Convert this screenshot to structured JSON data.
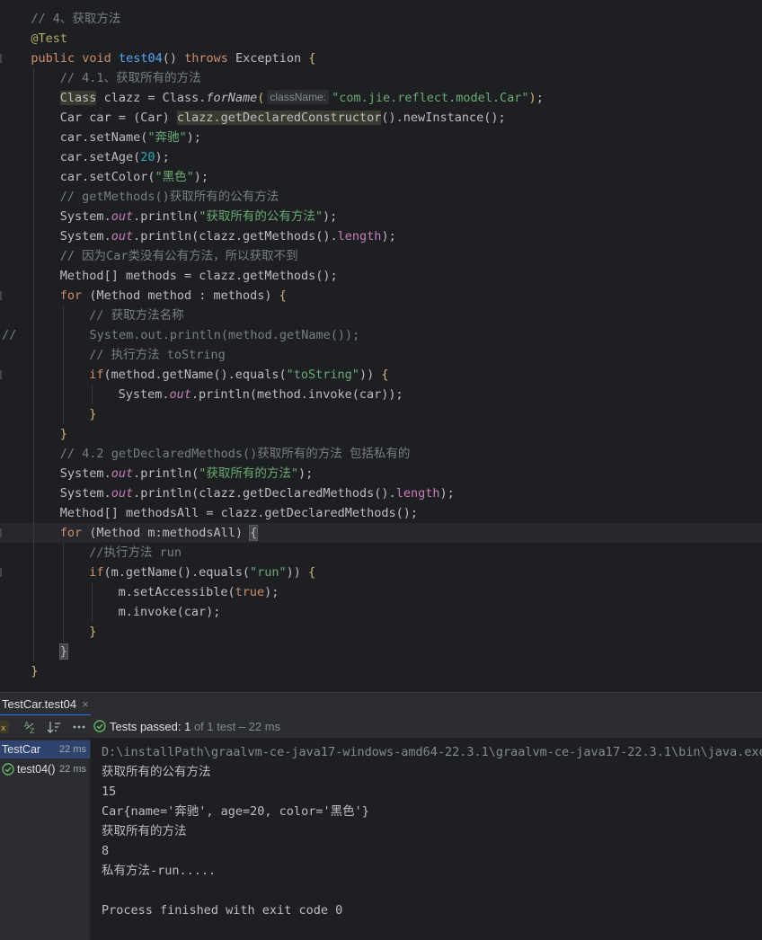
{
  "editor": {
    "lines": [
      {
        "indent": 4,
        "tokens": [
          [
            "com",
            "// 4、获取方法"
          ]
        ]
      },
      {
        "indent": 4,
        "tokens": [
          [
            "ann",
            "@Test"
          ]
        ]
      },
      {
        "indent": 4,
        "tokens": [
          [
            "kw",
            "public "
          ],
          [
            "kw",
            "void "
          ],
          [
            "mdecl",
            "test04"
          ],
          [
            "",
            "() "
          ],
          [
            "kw",
            "throws "
          ],
          [
            "",
            "Exception "
          ],
          [
            "pb1",
            "{"
          ]
        ]
      },
      {
        "indent": 8,
        "tokens": [
          [
            "com",
            "// 4.1、获取所有的方法"
          ]
        ]
      },
      {
        "indent": 8,
        "tokens": [
          [
            "bg-warn",
            "Class"
          ],
          [
            "",
            " clazz = Class."
          ],
          [
            "it",
            "forName"
          ],
          [
            "pb1",
            "("
          ],
          [
            "hint",
            "className:"
          ],
          [
            "str",
            "\"com.jie.reflect.model.Car\""
          ],
          [
            "pb1",
            ")"
          ],
          [
            "",
            ";"
          ]
        ]
      },
      {
        "indent": 8,
        "tokens": [
          [
            "",
            "Car car = (Car) "
          ],
          [
            "bg-warn",
            "clazz.getDeclaredConstructor"
          ],
          [
            "",
            "().newInstance();"
          ]
        ]
      },
      {
        "indent": 8,
        "tokens": [
          [
            "",
            "car.setName("
          ],
          [
            "str",
            "\"奔驰\""
          ],
          [
            "",
            ");"
          ]
        ]
      },
      {
        "indent": 8,
        "tokens": [
          [
            "",
            "car.setAge("
          ],
          [
            "num",
            "20"
          ],
          [
            "",
            ");"
          ]
        ]
      },
      {
        "indent": 8,
        "tokens": [
          [
            "",
            "car.setColor("
          ],
          [
            "str",
            "\"黑色\""
          ],
          [
            "",
            ");"
          ]
        ]
      },
      {
        "indent": 8,
        "tokens": [
          [
            "com",
            "// getMethods()获取所有的公有方法"
          ]
        ]
      },
      {
        "indent": 8,
        "tokens": [
          [
            "",
            "System."
          ],
          [
            "fld it",
            "out"
          ],
          [
            "",
            ".println("
          ],
          [
            "str",
            "\"获取所有的公有方法\""
          ],
          [
            "",
            ");"
          ]
        ]
      },
      {
        "indent": 8,
        "tokens": [
          [
            "",
            "System."
          ],
          [
            "fld it",
            "out"
          ],
          [
            "",
            ".println(clazz.getMethods()."
          ],
          [
            "fld",
            "length"
          ],
          [
            "",
            ");"
          ]
        ]
      },
      {
        "indent": 8,
        "tokens": [
          [
            "com",
            "// 因为Car类没有公有方法，所以获取不到"
          ]
        ]
      },
      {
        "indent": 8,
        "tokens": [
          [
            "",
            "Method[] methods = clazz.getMethods();"
          ]
        ]
      },
      {
        "indent": 8,
        "tokens": [
          [
            "kw",
            "for "
          ],
          [
            "",
            "(Method method : methods) "
          ],
          [
            "pb1",
            "{"
          ]
        ]
      },
      {
        "indent": 12,
        "tokens": [
          [
            "com",
            "// 获取方法名称"
          ]
        ]
      },
      {
        "indent": 0,
        "tokens": [
          [
            "com",
            "//          System.out.println(method.getName());"
          ]
        ]
      },
      {
        "indent": 12,
        "tokens": [
          [
            "com",
            "// 执行方法 toString"
          ]
        ]
      },
      {
        "indent": 12,
        "tokens": [
          [
            "kw",
            "if"
          ],
          [
            "",
            "(method.getName().equals("
          ],
          [
            "str",
            "\"toString\""
          ],
          [
            "",
            ")) "
          ],
          [
            "pb1",
            "{"
          ]
        ]
      },
      {
        "indent": 16,
        "tokens": [
          [
            "",
            "System."
          ],
          [
            "fld it",
            "out"
          ],
          [
            "",
            ".println(method.invoke(car));"
          ]
        ]
      },
      {
        "indent": 12,
        "tokens": [
          [
            "pb1",
            "}"
          ]
        ]
      },
      {
        "indent": 8,
        "tokens": [
          [
            "pb1",
            "}"
          ]
        ]
      },
      {
        "indent": 8,
        "tokens": [
          [
            "com",
            "// 4.2 getDeclaredMethods()获取所有的方法 包括私有的"
          ]
        ]
      },
      {
        "indent": 8,
        "tokens": [
          [
            "",
            "System."
          ],
          [
            "fld it",
            "out"
          ],
          [
            "",
            ".println("
          ],
          [
            "str",
            "\"获取所有的方法\""
          ],
          [
            "",
            ");"
          ]
        ]
      },
      {
        "indent": 8,
        "tokens": [
          [
            "",
            "System."
          ],
          [
            "fld it",
            "out"
          ],
          [
            "",
            ".println(clazz.getDeclaredMethods()."
          ],
          [
            "fld",
            "length"
          ],
          [
            "",
            ");"
          ]
        ]
      },
      {
        "indent": 8,
        "tokens": [
          [
            "",
            "Method[] methodsAll = clazz.getDeclaredMethods();"
          ]
        ]
      },
      {
        "indent": 8,
        "tokens": [
          [
            "kw",
            "for "
          ],
          [
            "",
            "(Method m:methodsAll) "
          ],
          [
            "brace-match",
            "{"
          ]
        ]
      },
      {
        "indent": 12,
        "tokens": [
          [
            "com",
            "//执行方法 run"
          ]
        ]
      },
      {
        "indent": 12,
        "tokens": [
          [
            "kw",
            "if"
          ],
          [
            "",
            "(m.getName().equals("
          ],
          [
            "str",
            "\"run\""
          ],
          [
            "",
            ")) "
          ],
          [
            "pb1",
            "{"
          ]
        ]
      },
      {
        "indent": 16,
        "tokens": [
          [
            "",
            "m.setAccessible("
          ],
          [
            "kw",
            "true"
          ],
          [
            "",
            ");"
          ]
        ]
      },
      {
        "indent": 16,
        "tokens": [
          [
            "",
            "m.invoke(car);"
          ]
        ]
      },
      {
        "indent": 12,
        "tokens": [
          [
            "pb1",
            "}"
          ]
        ]
      },
      {
        "indent": 8,
        "tokens": [
          [
            "brace-match",
            "}"
          ]
        ]
      },
      {
        "indent": 4,
        "tokens": [
          [
            "pb1",
            "}"
          ]
        ]
      }
    ]
  },
  "run_panel": {
    "tab_label": "TestCar.test04",
    "tab_close": "×",
    "status_prefix": "Tests passed: ",
    "status_passed": "1",
    "status_rest": " of 1 test – 22 ms",
    "tree": [
      {
        "label": "TestCar",
        "time": "22 ms"
      },
      {
        "label": "test04()",
        "time": "22 ms"
      }
    ],
    "console": [
      "D:\\installPath\\graalvm-ce-java17-windows-amd64-22.3.1\\graalvm-ce-java17-22.3.1\\bin\\java.exe",
      "获取所有的公有方法",
      "15",
      "Car{name='奔驰', age=20, color='黑色'}",
      "获取所有的方法",
      "8",
      "私有方法-run.....",
      "",
      "Process finished with exit code 0"
    ]
  },
  "icons": {
    "check": "check-circle-icon",
    "sort_alpha": "sort-alphabetically-icon",
    "sort_duration": "sort-by-duration-icon",
    "more": "more-icon"
  },
  "colors": {
    "keyword": "#cf8e6d",
    "string": "#6aab73",
    "comment": "#7a7e85",
    "number": "#2aacb8",
    "annotation": "#b3ae60",
    "method_decl": "#56a8f5",
    "field": "#c77dbb",
    "passed": "#5fb865"
  }
}
